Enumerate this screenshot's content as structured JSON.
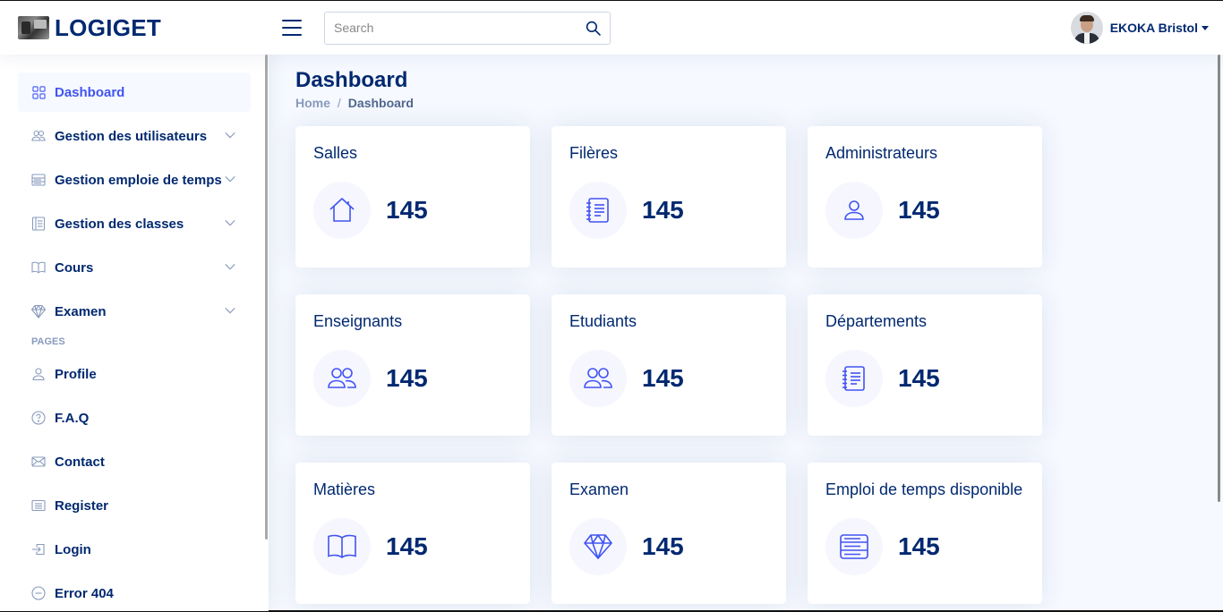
{
  "header": {
    "logo_text": "LOGIGET",
    "search_placeholder": "Search",
    "user_name": "EKOKA Bristol"
  },
  "sidebar": {
    "items": [
      {
        "label": "Dashboard",
        "icon": "grid-icon",
        "active": true
      },
      {
        "label": "Gestion des utilisateurs",
        "icon": "people-icon"
      },
      {
        "label": "Gestion emploie de temps",
        "icon": "layout-text-icon"
      },
      {
        "label": "Gestion des classes",
        "icon": "journal-text-icon"
      },
      {
        "label": "Cours",
        "icon": "book-icon"
      },
      {
        "label": "Examen",
        "icon": "gem-icon"
      }
    ],
    "pages_heading": "PAGES",
    "pages": [
      {
        "label": "Profile",
        "icon": "person-icon"
      },
      {
        "label": "F.A.Q",
        "icon": "question-circle-icon"
      },
      {
        "label": "Contact",
        "icon": "envelope-icon"
      },
      {
        "label": "Register",
        "icon": "card-list-icon"
      },
      {
        "label": "Login",
        "icon": "box-arrow-in-right-icon"
      },
      {
        "label": "Error 404",
        "icon": "dash-circle-icon"
      }
    ]
  },
  "main": {
    "title": "Dashboard",
    "breadcrumb": {
      "home": "Home",
      "separator": "/",
      "current": "Dashboard"
    },
    "cards": [
      {
        "title": "Salles",
        "value": "145",
        "icon": "house-icon"
      },
      {
        "title": "Filères",
        "value": "145",
        "icon": "journal-text-icon"
      },
      {
        "title": "Administrateurs",
        "value": "145",
        "icon": "person-icon"
      },
      {
        "title": "Enseignants",
        "value": "145",
        "icon": "people-icon"
      },
      {
        "title": "Etudiants",
        "value": "145",
        "icon": "people-icon"
      },
      {
        "title": "Départements",
        "value": "145",
        "icon": "journal-text-icon"
      },
      {
        "title": "Matières",
        "value": "145",
        "icon": "book-icon"
      },
      {
        "title": "Examen",
        "value": "145",
        "icon": "gem-icon"
      },
      {
        "title": "Emploi de temps disponible",
        "value": "145",
        "icon": "layout-text-icon"
      }
    ]
  },
  "colors": {
    "primary": "#012970",
    "accent": "#4154f1",
    "muted": "#899bbd",
    "background": "#f6f9ff"
  }
}
